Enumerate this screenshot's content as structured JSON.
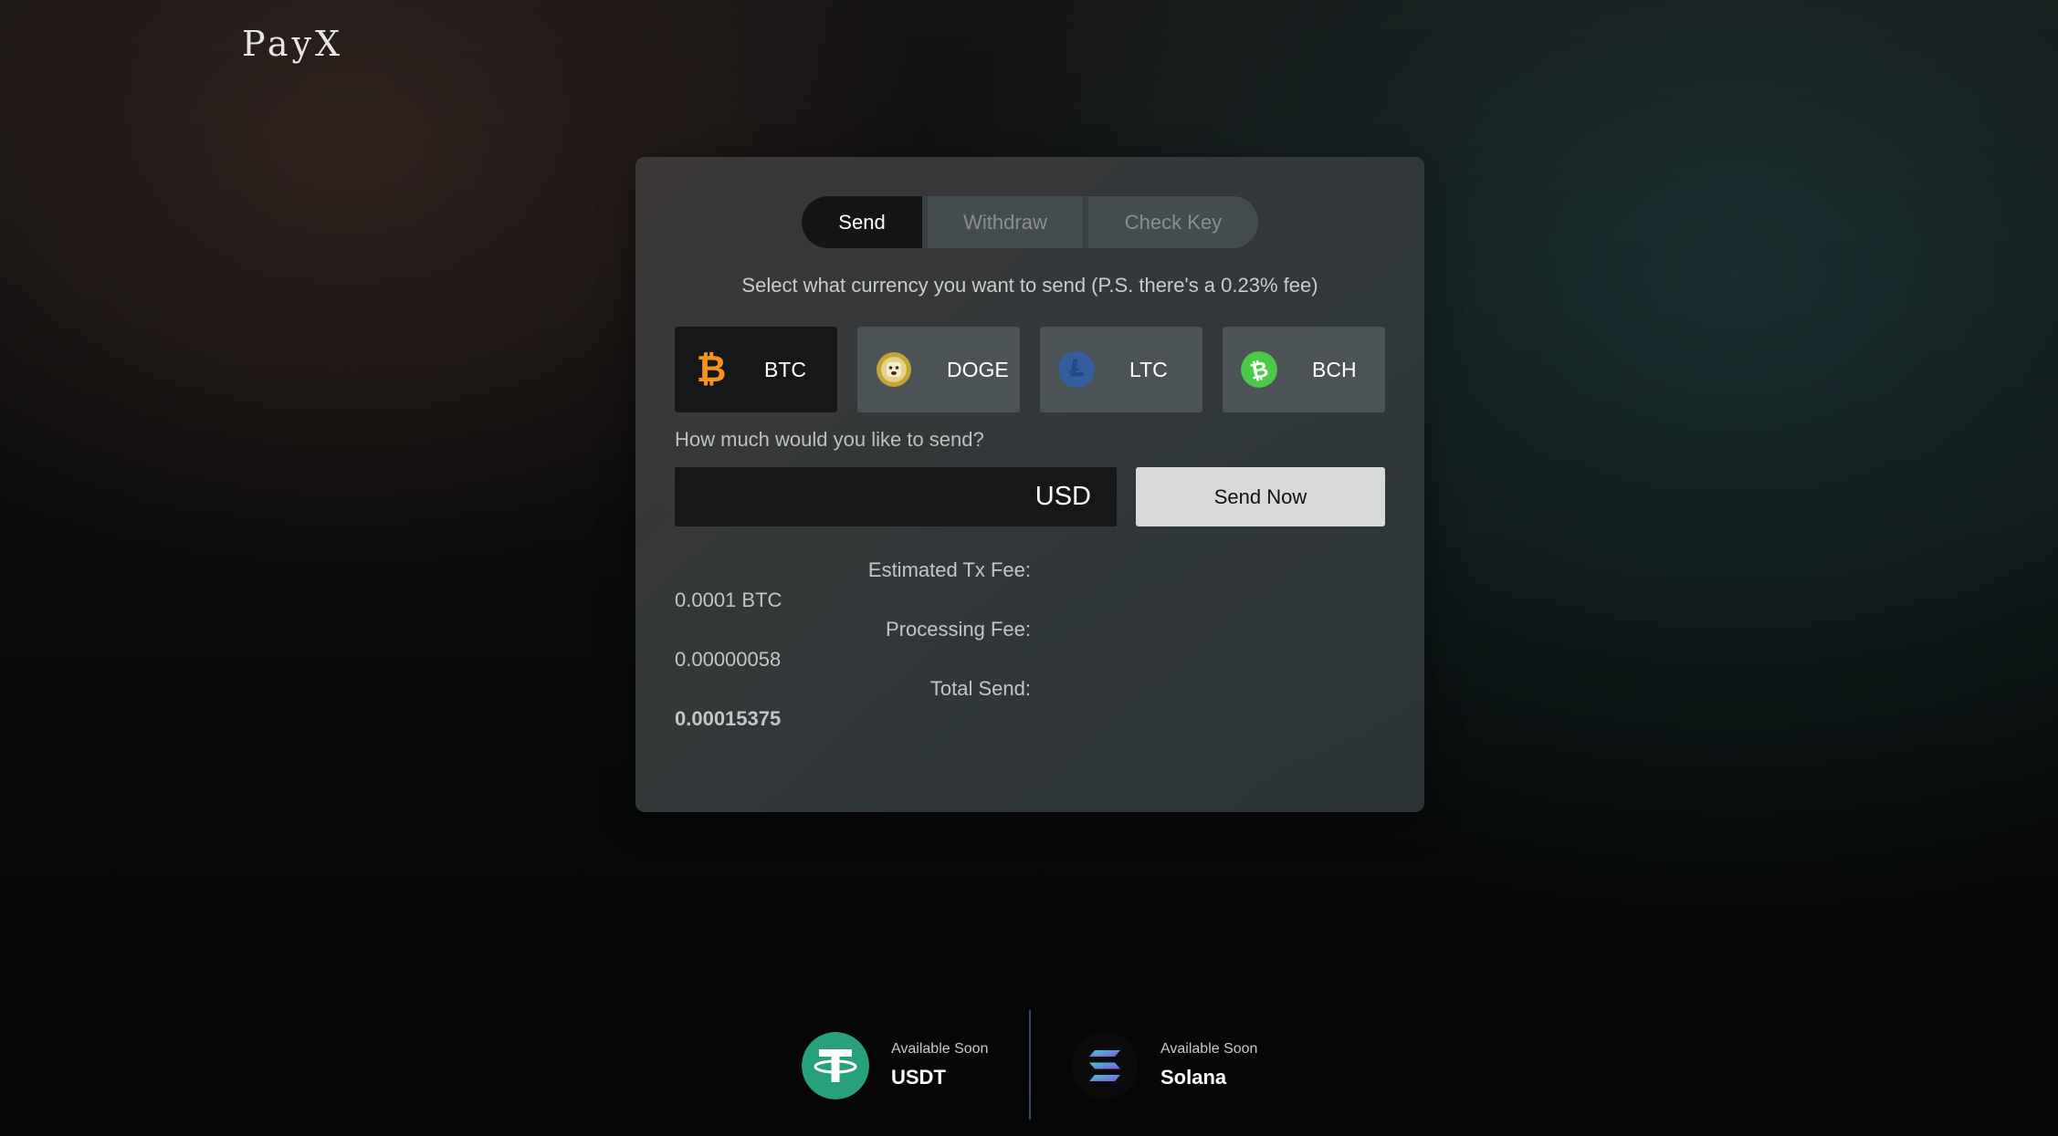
{
  "brand": {
    "logo_text": "PayX"
  },
  "tabs": [
    {
      "label": "Send",
      "active": true
    },
    {
      "label": "Withdraw",
      "active": false
    },
    {
      "label": "Check Key",
      "active": false
    }
  ],
  "subtitle": "Select what currency you want to send (P.S. there's a 0.23% fee)",
  "coins": [
    {
      "label": "BTC",
      "icon": "bitcoin-icon",
      "color": "#f7931a",
      "selected": true
    },
    {
      "label": "DOGE",
      "icon": "dogecoin-icon",
      "color": "#c2a633",
      "selected": false
    },
    {
      "label": "LTC",
      "icon": "litecoin-icon",
      "color": "#345d9d",
      "selected": false
    },
    {
      "label": "BCH",
      "icon": "bitcoin-cash-icon",
      "color": "#4cc947",
      "selected": false
    }
  ],
  "amount": {
    "question": "How much would you like to send?",
    "value": "",
    "unit": "USD",
    "send_button": "Send Now"
  },
  "fees": {
    "tx_fee_label": "Estimated Tx Fee:",
    "tx_fee_value": "0.0001 BTC",
    "processing_label": "Processing Fee:",
    "processing_value": "0.00000058",
    "total_label": "Total Send:",
    "total_value": "0.00015375"
  },
  "coming_soon": [
    {
      "status": "Available Soon",
      "name": "USDT",
      "icon": "tether-icon",
      "color": "#26a17b"
    },
    {
      "status": "Available Soon",
      "name": "Solana",
      "icon": "solana-icon",
      "color": "#0b0b0b"
    }
  ]
}
